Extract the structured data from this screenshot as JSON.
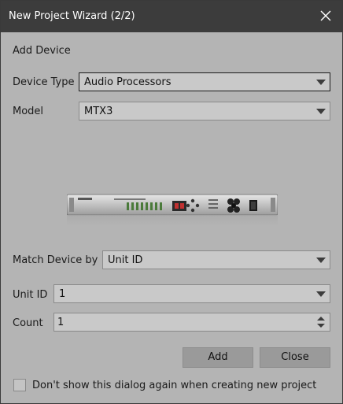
{
  "window": {
    "title": "New Project Wizard (2/2)"
  },
  "section": {
    "heading": "Add Device"
  },
  "device_type": {
    "label": "Device Type",
    "value": "Audio Processors"
  },
  "model": {
    "label": "Model",
    "value": "MTX3"
  },
  "match_device_by": {
    "label": "Match Device by",
    "value": "Unit ID"
  },
  "unit_id": {
    "label": "Unit ID",
    "value": "1"
  },
  "count": {
    "label": "Count",
    "value": "1"
  },
  "buttons": {
    "add": "Add",
    "close": "Close"
  },
  "checkbox": {
    "label": "Don't show this dialog again when creating new project",
    "checked": false
  },
  "icons": {
    "close": "close-icon",
    "dropdown": "chevron-down-icon",
    "spinner": "spinner-arrows-icon"
  }
}
